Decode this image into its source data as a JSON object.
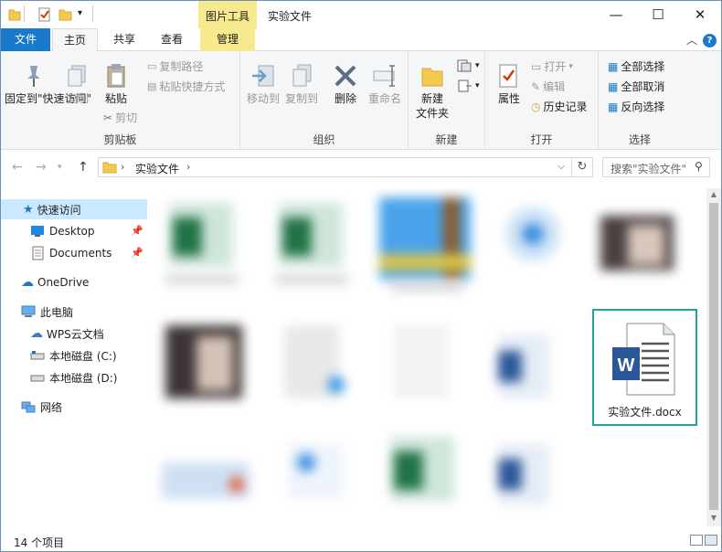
{
  "window": {
    "context_group": "图片工具",
    "title": "实验文件",
    "minimize": "—",
    "maximize": "☐",
    "close": "✕"
  },
  "tabs": {
    "file": "文件",
    "home": "主页",
    "share": "共享",
    "view": "查看",
    "manage": "管理"
  },
  "ribbon": {
    "clipboard": {
      "label": "剪贴板",
      "pin": "固定到\"快速访问\"",
      "copy": "复制",
      "paste": "粘贴",
      "copy_path": "复制路径",
      "paste_shortcut": "粘贴快捷方式",
      "cut": "剪切"
    },
    "organize": {
      "label": "组织",
      "move_to": "移动到",
      "copy_to": "复制到",
      "delete": "删除",
      "rename": "重命名"
    },
    "new": {
      "label": "新建",
      "new_folder": "新建\n文件夹"
    },
    "open": {
      "label": "打开",
      "properties": "属性",
      "open": "打开",
      "edit": "编辑",
      "history": "历史记录"
    },
    "select": {
      "label": "选择",
      "select_all": "全部选择",
      "select_none": "全部取消",
      "invert": "反向选择"
    }
  },
  "address": {
    "path": "实验文件",
    "search_placeholder": "搜索\"实验文件\""
  },
  "nav": {
    "quick_access": "快速访问",
    "desktop": "Desktop",
    "documents": "Documents",
    "onedrive": "OneDrive",
    "this_pc": "此电脑",
    "wps": "WPS云文档",
    "disk_c": "本地磁盘 (C:)",
    "disk_d": "本地磁盘 (D:)",
    "network": "网络"
  },
  "content": {
    "highlighted_file": "实验文件.docx",
    "icon_letter": "W"
  },
  "status": {
    "count": "14 个项目"
  },
  "colors": {
    "accent": "#1979ca",
    "context_tab": "#f7e98e",
    "highlight_border": "#1ea59a",
    "word_blue": "#2b579a"
  }
}
